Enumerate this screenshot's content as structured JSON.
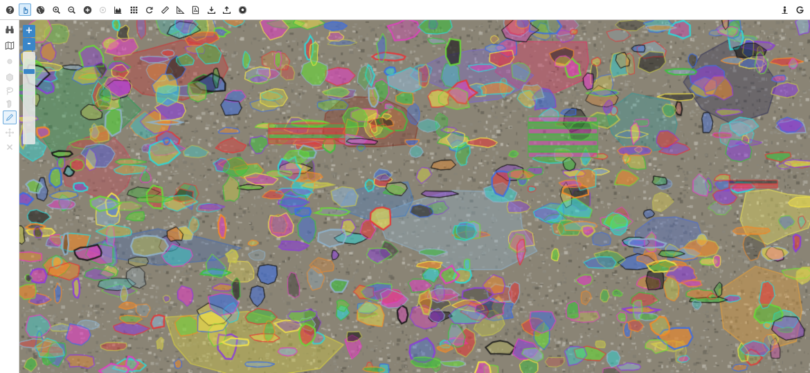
{
  "toolbar": {
    "left_tools": [
      {
        "name": "help-button",
        "icon": "question-circle-icon",
        "active": false
      },
      {
        "name": "pan-hand-button",
        "icon": "hand-pointer-icon",
        "active": true
      },
      {
        "name": "globe-button",
        "icon": "globe-icon",
        "active": false
      },
      {
        "name": "zoom-in-button",
        "icon": "magnifier-plus-icon",
        "active": false
      },
      {
        "name": "zoom-out-button",
        "icon": "magnifier-minus-icon",
        "active": false
      },
      {
        "name": "full-extent-button",
        "icon": "plus-circle-icon",
        "active": false
      },
      {
        "name": "disabled-circle-button",
        "icon": "circle-outline-icon",
        "active": false
      },
      {
        "name": "area-chart-button",
        "icon": "area-chart-icon",
        "active": false
      },
      {
        "name": "grid-button",
        "icon": "grid-icon",
        "active": false
      },
      {
        "name": "refresh-button",
        "icon": "refresh-icon",
        "active": false
      },
      {
        "name": "measure-distance-button",
        "icon": "ruler-icon",
        "active": false
      },
      {
        "name": "measure-area-button",
        "icon": "triangle-ruler-icon",
        "active": false
      },
      {
        "name": "pdf-export-button",
        "icon": "pdf-file-icon",
        "active": false
      },
      {
        "name": "download-button",
        "icon": "download-icon",
        "active": false
      },
      {
        "name": "upload-button",
        "icon": "upload-icon",
        "active": false
      },
      {
        "name": "soccer-ball-button",
        "icon": "soccer-ball-icon",
        "active": false
      }
    ],
    "right_tools": [
      {
        "name": "street-view-button",
        "icon": "person-icon"
      },
      {
        "name": "google-button",
        "icon": "google-g-icon"
      }
    ]
  },
  "sidebar": {
    "tools": [
      {
        "name": "binoculars-button",
        "icon": "binoculars-icon",
        "enabled": true,
        "active": false
      },
      {
        "name": "map-layers-button",
        "icon": "folded-map-icon",
        "enabled": true,
        "active": false
      },
      {
        "name": "draw-point-button",
        "icon": "circle-icon",
        "enabled": false,
        "active": false
      },
      {
        "name": "draw-polygon-button",
        "icon": "hexagon-icon",
        "enabled": false,
        "active": false
      },
      {
        "name": "draw-freehand-button",
        "icon": "lasso-icon",
        "enabled": false,
        "active": false
      },
      {
        "name": "select-button",
        "icon": "hand-select-icon",
        "enabled": false,
        "active": false
      },
      {
        "name": "edit-pencil-button",
        "icon": "pencil-icon",
        "enabled": false,
        "active": true
      },
      {
        "name": "move-button",
        "icon": "move-arrows-icon",
        "enabled": false,
        "active": false
      },
      {
        "name": "delete-button",
        "icon": "x-icon",
        "enabled": false,
        "active": false
      }
    ]
  },
  "map": {
    "zoom_in_label": "+",
    "zoom_out_label": "-",
    "zoom_level_fraction": 0.8,
    "basemap": "satellite-imagery",
    "overlay": "parcel-polygons",
    "colors": {
      "accent": "#3a86c8",
      "active_outline": "#6aa9dd",
      "parcel_palette": [
        "#e23b3b",
        "#8c3fd9",
        "#3fbf3f",
        "#2fd6d6",
        "#f0e04a",
        "#3f6fe0",
        "#e040c0",
        "#f08a2a",
        "#6ad63a",
        "#1a1a1a",
        "#c0c050",
        "#8fb0c8"
      ]
    }
  }
}
